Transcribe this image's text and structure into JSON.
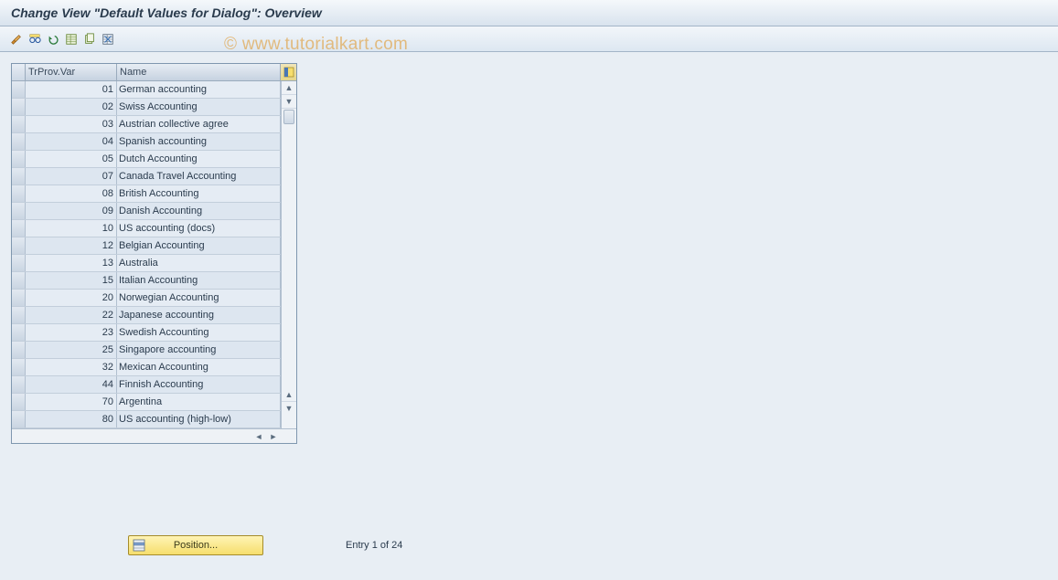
{
  "title": "Change View \"Default Values for Dialog\": Overview",
  "watermark": "© www.tutorialkart.com",
  "toolbar": {
    "icons": [
      "pencil-double-icon",
      "glasses-select-icon",
      "undo-icon",
      "new-entries-icon",
      "copy-icon",
      "delete-icon"
    ]
  },
  "table": {
    "header_var": "TrProv.Var",
    "header_name": "Name",
    "config_icon": "table-settings-icon",
    "rows": [
      {
        "var": "01",
        "name": "German accounting"
      },
      {
        "var": "02",
        "name": "Swiss Accounting"
      },
      {
        "var": "03",
        "name": "Austrian collective agree"
      },
      {
        "var": "04",
        "name": "Spanish accounting"
      },
      {
        "var": "05",
        "name": "Dutch Accounting"
      },
      {
        "var": "07",
        "name": "Canada Travel Accounting"
      },
      {
        "var": "08",
        "name": "British Accounting"
      },
      {
        "var": "09",
        "name": "Danish Accounting"
      },
      {
        "var": "10",
        "name": "US accounting (docs)"
      },
      {
        "var": "12",
        "name": "Belgian Accounting"
      },
      {
        "var": "13",
        "name": "Australia"
      },
      {
        "var": "15",
        "name": "Italian Accounting"
      },
      {
        "var": "20",
        "name": "Norwegian Accounting"
      },
      {
        "var": "22",
        "name": "Japanese accounting"
      },
      {
        "var": "23",
        "name": "Swedish Accounting"
      },
      {
        "var": "25",
        "name": "Singapore accounting"
      },
      {
        "var": "32",
        "name": "Mexican Accounting"
      },
      {
        "var": "44",
        "name": "Finnish Accounting"
      },
      {
        "var": "70",
        "name": "Argentina"
      },
      {
        "var": "80",
        "name": "US accounting (high-low)"
      }
    ]
  },
  "footer": {
    "position_label": "Position...",
    "entry_text": "Entry 1 of 24"
  }
}
